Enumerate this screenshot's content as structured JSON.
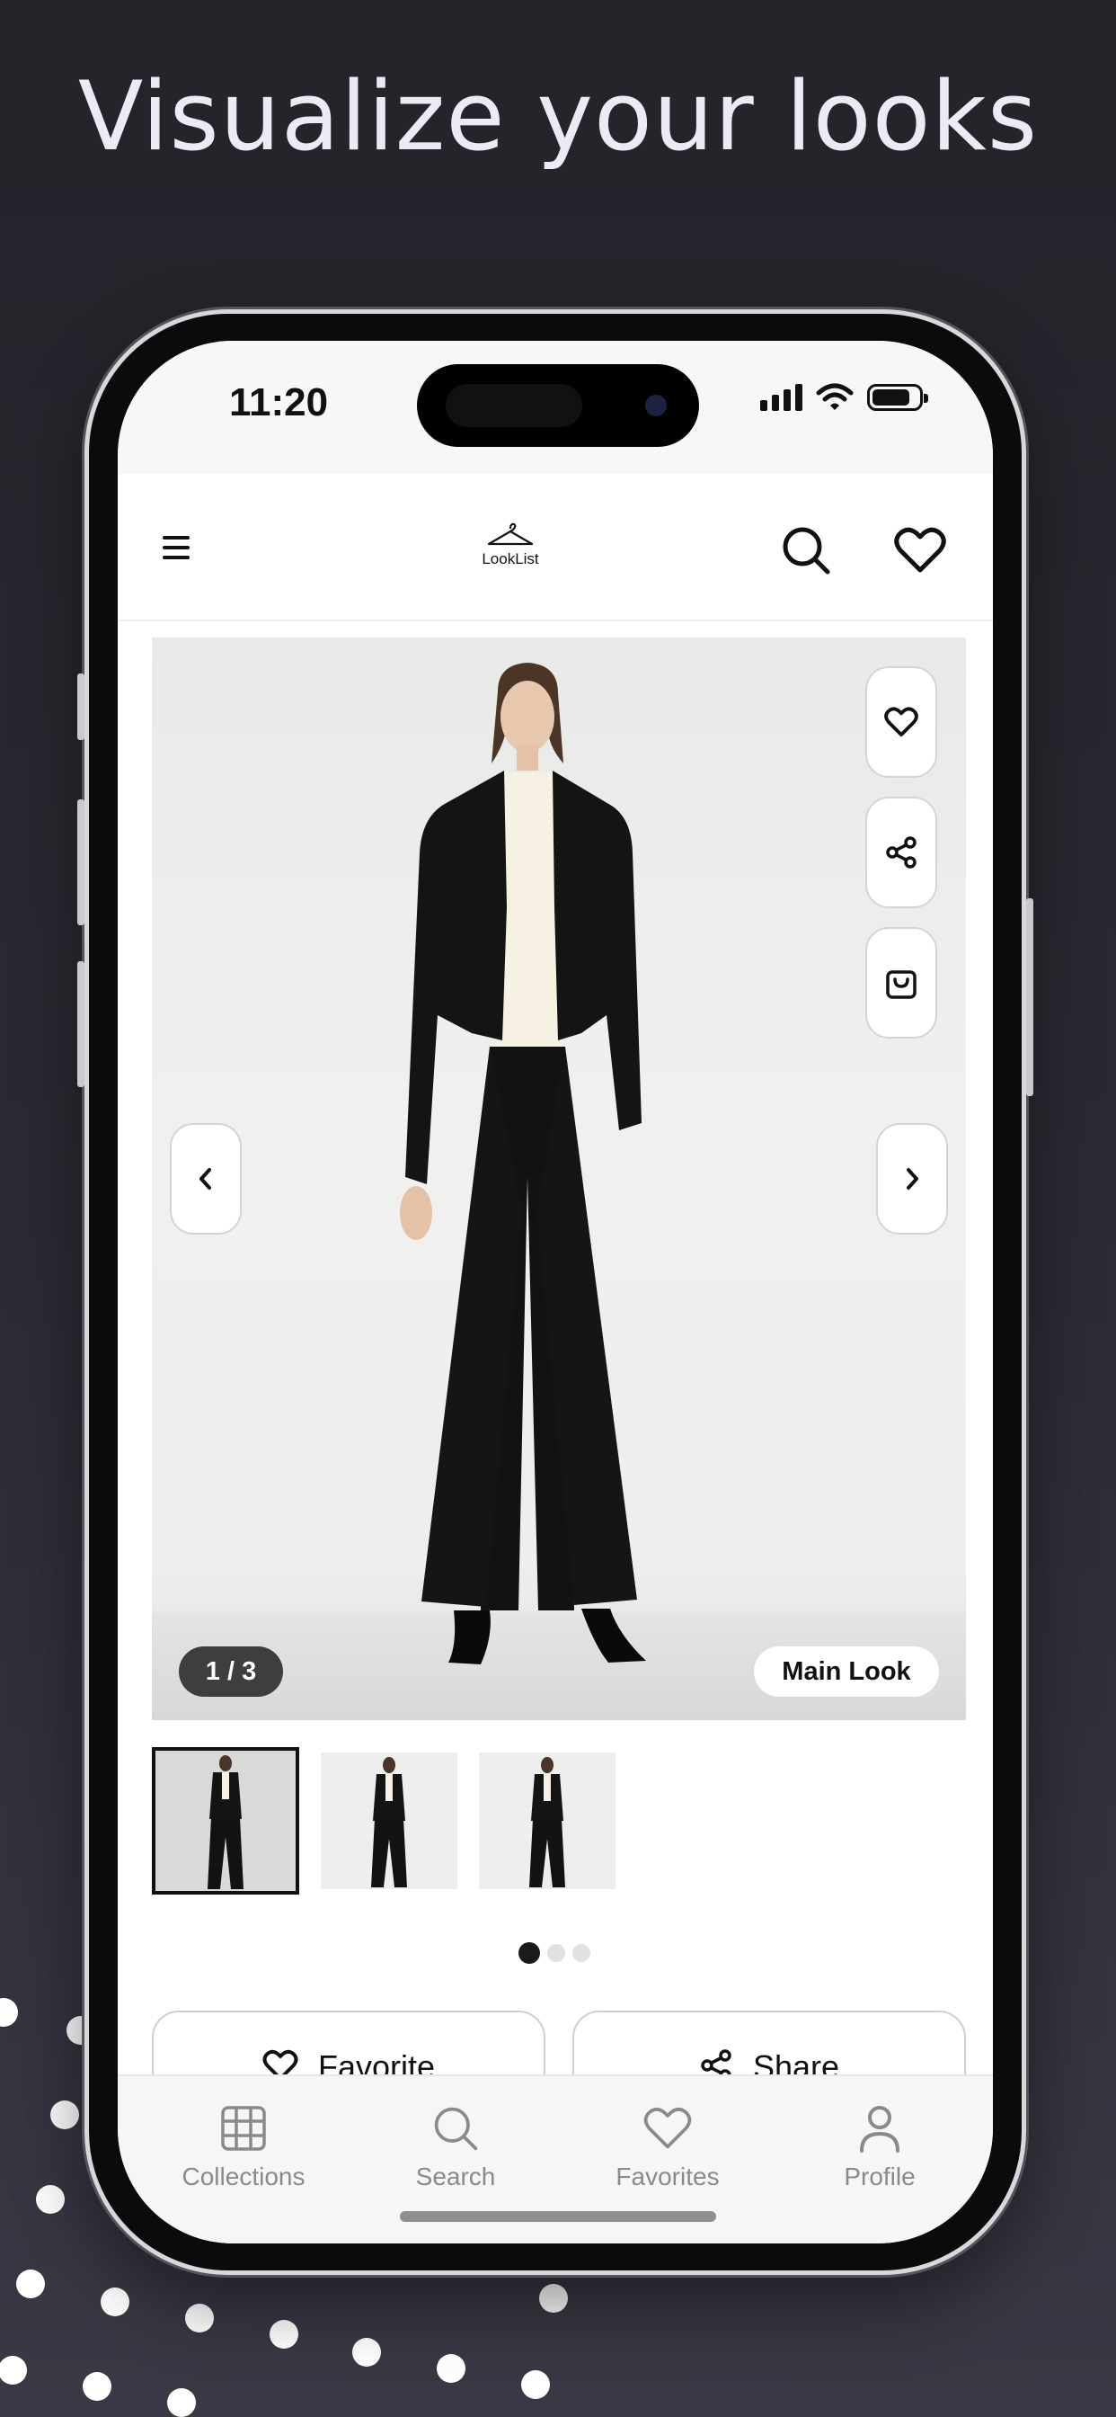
{
  "headline": "Visualize your looks",
  "status_bar": {
    "time": "11:20"
  },
  "header": {
    "logo_text": "LookList",
    "menu_icon": "hamburger-icon",
    "search_icon": "search-icon",
    "favorites_icon": "heart-icon"
  },
  "hero": {
    "image_counter": "1 / 3",
    "look_label": "Main Look",
    "actions": [
      "heart-icon",
      "share-icon",
      "shopping-bag-icon"
    ],
    "prev_icon": "chevron-left-icon",
    "next_icon": "chevron-right-icon"
  },
  "thumbnails": {
    "count": 3,
    "active_index": 0
  },
  "pager": {
    "pages": 3,
    "active": 0
  },
  "actions": {
    "favorite_label": "Favorite",
    "share_label": "Share"
  },
  "tabbar": {
    "items": [
      {
        "label": "Collections",
        "icon": "grid-icon"
      },
      {
        "label": "Search",
        "icon": "search-icon"
      },
      {
        "label": "Favorites",
        "icon": "heart-icon"
      },
      {
        "label": "Profile",
        "icon": "person-icon"
      }
    ]
  },
  "colors": {
    "background": "#2b2a33",
    "accent": "#111111",
    "tab_inactive": "#8a8a8e"
  }
}
